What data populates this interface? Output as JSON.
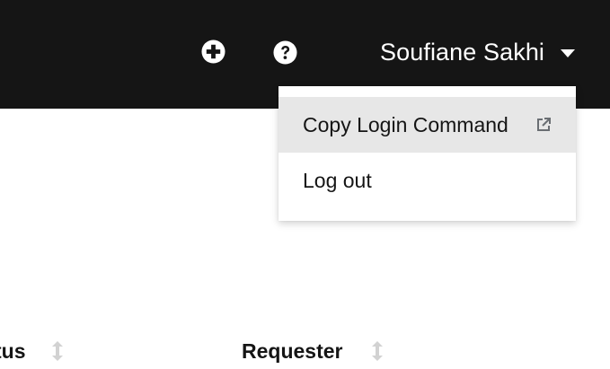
{
  "masthead": {
    "add_icon": "plus-circle-icon",
    "help_icon": "question-circle-icon",
    "user": {
      "name": "Soufiane Sakhi",
      "caret_icon": "caret-down-icon"
    }
  },
  "user_menu": {
    "items": [
      {
        "label": "Copy Login Command",
        "icon": "external-link-icon",
        "highlighted": true
      },
      {
        "label": "Log out"
      }
    ]
  },
  "table": {
    "columns": [
      {
        "label": "tus",
        "sort_icon": "sort-icon"
      },
      {
        "label": "Requester",
        "sort_icon": "sort-icon"
      }
    ]
  },
  "colors": {
    "masthead_bg": "#151515",
    "menu_hover_bg": "#e7e7e7",
    "icon_light": "#ffffff",
    "sort_icon": "#d2d2d2",
    "text": "#151515"
  }
}
